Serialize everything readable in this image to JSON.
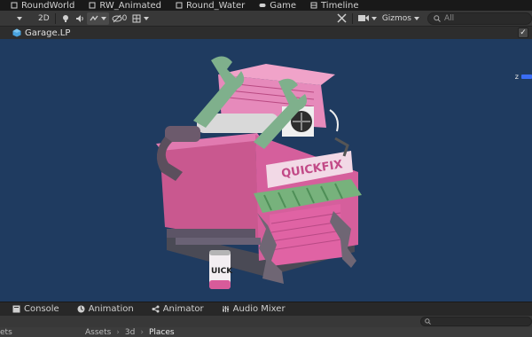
{
  "top_tabs": [
    {
      "label": "RoundWorld"
    },
    {
      "label": "RW_Animated"
    },
    {
      "label": "Round_Water"
    },
    {
      "label": "Game"
    },
    {
      "label": "Timeline"
    }
  ],
  "toolbar": {
    "mode_2d": "2D",
    "hidden_count": "0",
    "gizmos_label": "Gizmos",
    "search_placeholder": "All"
  },
  "breadcrumb": {
    "title": "Garage.LP",
    "checked": "✓"
  },
  "viewport": {
    "sign_text": "QUICKFIX",
    "can_text": "UICK",
    "gizmo_axis_label": "z"
  },
  "bottom_tabs": [
    {
      "label": "Console"
    },
    {
      "label": "Animation"
    },
    {
      "label": "Animator"
    },
    {
      "label": "Audio Mixer"
    }
  ],
  "path_bar": {
    "left_text": "ets",
    "crumbs": [
      "Assets",
      "3d",
      "Places"
    ]
  },
  "colors": {
    "viewport_bg": "#1f3b60",
    "garage_pink": "#d95f9e",
    "wrench_green": "#7fb08c",
    "gizmo_blue": "#3a6df5"
  }
}
